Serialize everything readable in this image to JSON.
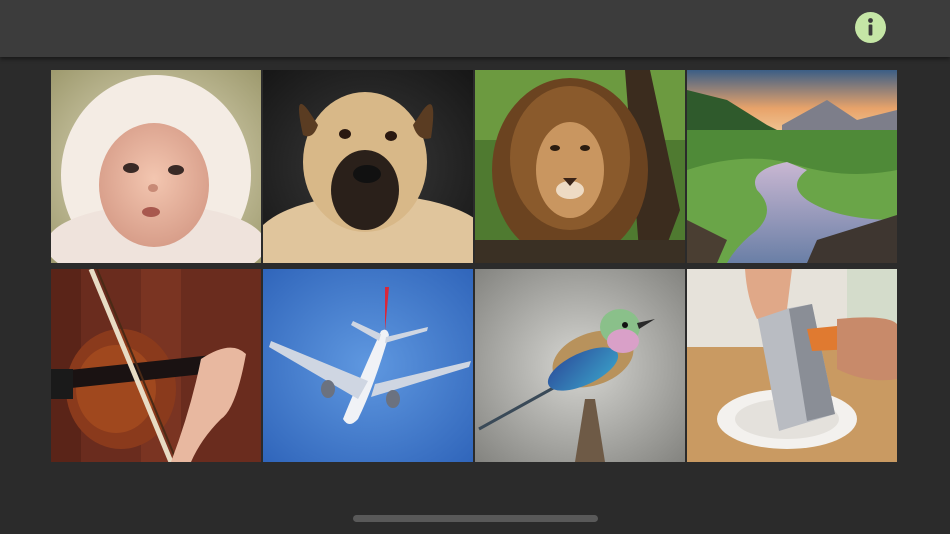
{
  "header": {
    "info_icon": "info-icon",
    "info_glyph": "i",
    "info_color": "#c5e6a6"
  },
  "tiles": [
    {
      "subject": "baby",
      "icon": "baby-image"
    },
    {
      "subject": "dog",
      "icon": "dog-image"
    },
    {
      "subject": "lion",
      "icon": "lion-image"
    },
    {
      "subject": "landscape",
      "icon": "landscape-image"
    },
    {
      "subject": "violin",
      "icon": "violin-image"
    },
    {
      "subject": "airplane",
      "icon": "airplane-image"
    },
    {
      "subject": "bird",
      "icon": "bird-image"
    },
    {
      "subject": "grater",
      "icon": "grater-image"
    }
  ]
}
